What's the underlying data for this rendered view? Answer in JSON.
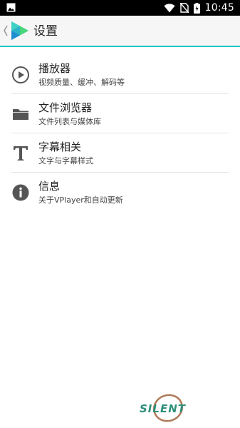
{
  "status_bar": {
    "time": "10:45",
    "icons": [
      "image-notification-icon",
      "wifi-icon",
      "no-sim-icon",
      "battery-charging-icon"
    ]
  },
  "toolbar": {
    "back_glyph": "‹",
    "title": "设置",
    "accent_color": "#20c6c0"
  },
  "settings": [
    {
      "icon": "play-circle-icon",
      "title": "播放器",
      "subtitle": "视频质量、缓冲、解码等"
    },
    {
      "icon": "folder-icon",
      "title": "文件浏览器",
      "subtitle": "文件列表与媒体库"
    },
    {
      "icon": "text-format-icon",
      "title": "字幕相关",
      "subtitle": "文字与字幕样式"
    },
    {
      "icon": "info-icon",
      "title": "信息",
      "subtitle": "关于VPlayer和自动更新"
    }
  ],
  "watermark": {
    "text": "SILENT"
  }
}
